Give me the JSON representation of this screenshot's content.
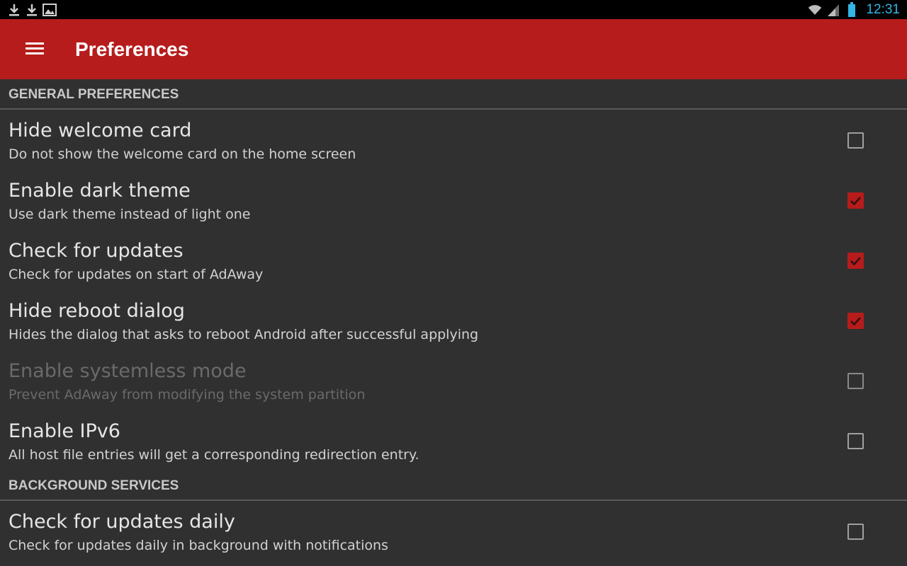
{
  "status_bar": {
    "time": "12:31",
    "left_icons": [
      "download-icon",
      "download-icon",
      "image-icon"
    ],
    "right_icons": [
      "wifi-icon",
      "signal-icon",
      "battery-icon"
    ],
    "time_color": "#33b5e5"
  },
  "app_bar": {
    "title": "Preferences",
    "menu_icon": "hamburger-menu-icon",
    "color": "#b71c1c"
  },
  "sections": [
    {
      "header": "GENERAL PREFERENCES",
      "items": [
        {
          "title": "Hide welcome card",
          "summary": "Do not show the welcome card on the home screen",
          "checked": false,
          "enabled": true
        },
        {
          "title": "Enable dark theme",
          "summary": "Use dark theme instead of light one",
          "checked": true,
          "enabled": true
        },
        {
          "title": "Check for updates",
          "summary": "Check for updates on start of AdAway",
          "checked": true,
          "enabled": true
        },
        {
          "title": "Hide reboot dialog",
          "summary": "Hides the dialog that asks to reboot Android after successful applying",
          "checked": true,
          "enabled": true
        },
        {
          "title": "Enable systemless mode",
          "summary": "Prevent AdAway from modifying the system partition",
          "checked": false,
          "enabled": false
        },
        {
          "title": "Enable IPv6",
          "summary": "All host file entries will get a corresponding redirection entry.",
          "checked": false,
          "enabled": true
        }
      ]
    },
    {
      "header": "BACKGROUND SERVICES",
      "items": [
        {
          "title": "Check for updates daily",
          "summary": "Check for updates daily in background with notifications",
          "checked": false,
          "enabled": true
        }
      ]
    }
  ]
}
